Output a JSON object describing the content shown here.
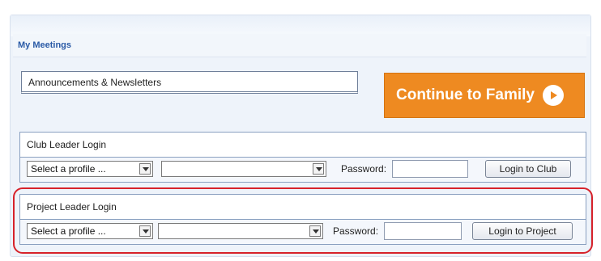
{
  "meetings": {
    "link_label": "My Meetings"
  },
  "announcements": {
    "label": "Announcements & Newsletters"
  },
  "family_button": {
    "label": "Continue to Family",
    "color": "#ee8a21"
  },
  "club_login": {
    "title": "Club Leader Login",
    "profile_select": "Select a profile ...",
    "second_select": "",
    "password_label": "Password:",
    "password_value": "",
    "button_label": "Login to Club"
  },
  "project_login": {
    "title": "Project Leader Login",
    "profile_select": "Select a profile ...",
    "second_select": "",
    "password_label": "Password:",
    "password_value": "",
    "button_label": "Login to Project",
    "highlight_color": "#d7222a"
  }
}
